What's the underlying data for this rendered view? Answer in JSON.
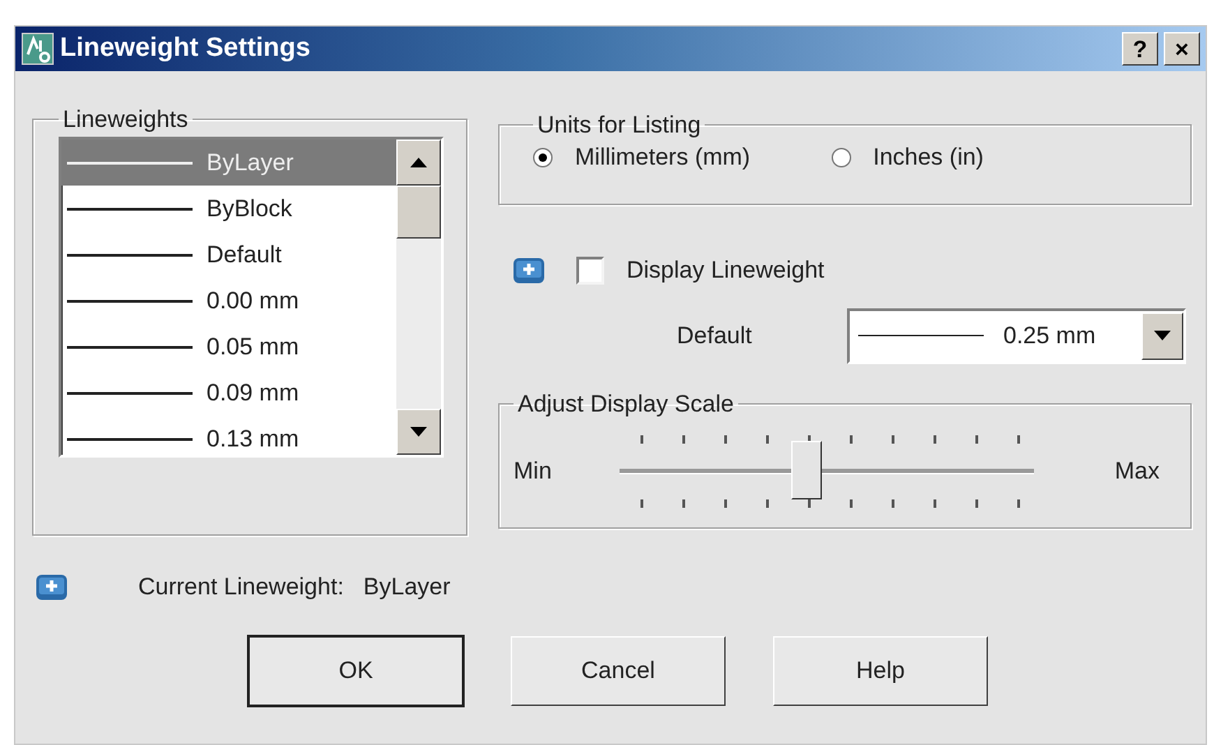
{
  "window": {
    "title": "Lineweight Settings",
    "help_button": "?",
    "close_button": "×"
  },
  "lineweights": {
    "title": "Lineweights",
    "items": [
      {
        "label": "ByLayer",
        "selected": true
      },
      {
        "label": "ByBlock",
        "selected": false
      },
      {
        "label": "Default",
        "selected": false
      },
      {
        "label": "0.00 mm",
        "selected": false
      },
      {
        "label": "0.05 mm",
        "selected": false
      },
      {
        "label": "0.09 mm",
        "selected": false
      },
      {
        "label": "0.13 mm",
        "selected": false
      }
    ]
  },
  "units": {
    "title": "Units for Listing",
    "options": [
      {
        "label": "Millimeters (mm)",
        "selected": true
      },
      {
        "label": "Inches (in)",
        "selected": false
      }
    ]
  },
  "display_lineweight": {
    "label": "Display Lineweight",
    "checked": false
  },
  "default": {
    "label": "Default",
    "value": "0.25 mm"
  },
  "display_scale": {
    "title": "Adjust Display Scale",
    "min_label": "Min",
    "max_label": "Max",
    "level": 0.45
  },
  "current": {
    "label": "Current Lineweight:",
    "value": "ByLayer"
  },
  "buttons": [
    {
      "label": "OK",
      "default": true
    },
    {
      "label": "Cancel",
      "default": false
    },
    {
      "label": "Help",
      "default": false
    }
  ]
}
